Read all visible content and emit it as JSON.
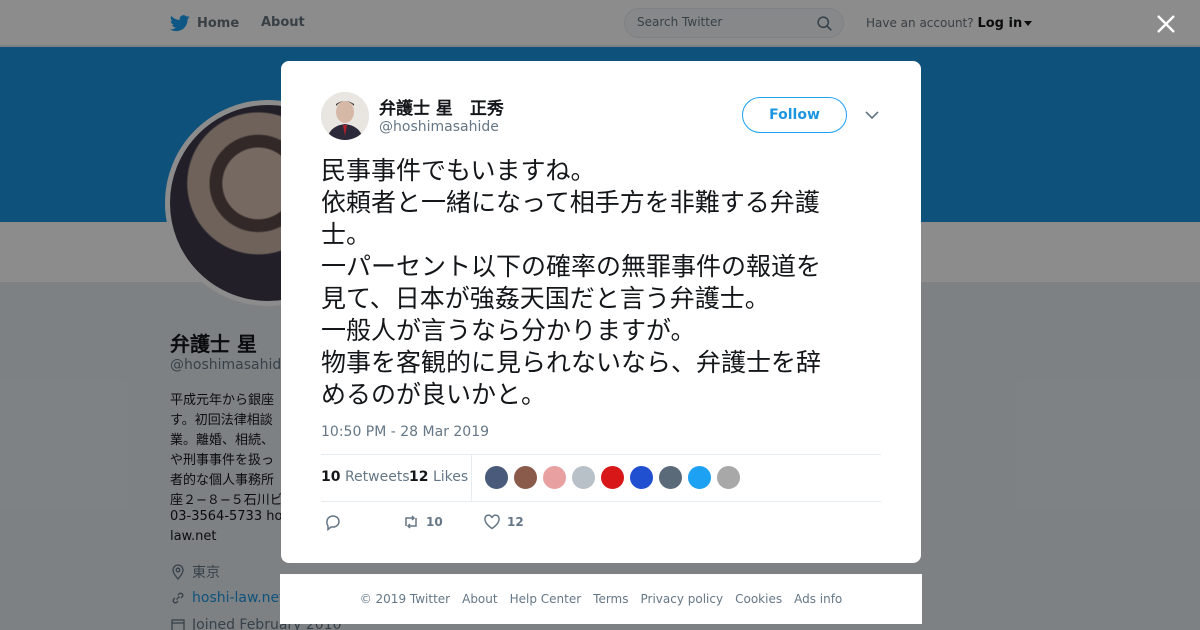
{
  "nav": {
    "home": "Home",
    "about": "About",
    "search_placeholder": "Search Twitter",
    "account_prompt": "Have an account?",
    "login": "Log in"
  },
  "profile": {
    "name": "弁護士 星",
    "handle": "@hoshimasahide",
    "bio_lines": [
      "平成元年から銀座",
      "す。初回法律相談",
      "業。離婚、相続、",
      "や刑事事件を扱っ",
      "者的な個人事務所",
      "座２−８−５石川ビ",
      "03-3564-5733 hos",
      "law.net"
    ],
    "location": "東京",
    "website": "hoshi-law.net",
    "joined": "Joined February 2010"
  },
  "tweet": {
    "author_name": "弁護士 星　正秀",
    "author_handle": "@hoshimasahide",
    "follow_label": "Follow",
    "text_lines": [
      "民事事件でもいますね。",
      "依頼者と一緒になって相手方を非難する弁護",
      "士。",
      "一パーセント以下の確率の無罪事件の報道を",
      "見て、日本が強姦天国だと言う弁護士。",
      "一般人が言うなら分かりますが。",
      "物事を客観的に見られないなら、弁護士を辞",
      "めるのが良いかと。"
    ],
    "timestamp": "10:50 PM - 28 Mar 2019",
    "retweets_count": "10",
    "retweets_label": "Retweets",
    "likes_count": "12",
    "likes_label": "Likes",
    "reply_count": "",
    "retweet_action_count": "10",
    "like_action_count": "12"
  },
  "likers": [
    {
      "name": "liker-1",
      "color": "#4a5a7a"
    },
    {
      "name": "liker-2",
      "color": "#8a5a4a"
    },
    {
      "name": "liker-3",
      "color": "#e8a0a0"
    },
    {
      "name": "liker-4",
      "color": "#b8c0c8"
    },
    {
      "name": "liker-5",
      "color": "#d81818"
    },
    {
      "name": "liker-6",
      "color": "#2050d0"
    },
    {
      "name": "liker-7",
      "color": "#5a6a78"
    },
    {
      "name": "liker-8",
      "color": "#1da1f2"
    },
    {
      "name": "liker-9",
      "color": "#a8a8a8"
    }
  ],
  "footer": {
    "copyright": "© 2019 Twitter",
    "links": [
      "About",
      "Help Center",
      "Terms",
      "Privacy policy",
      "Cookies",
      "Ads info"
    ]
  },
  "colors": {
    "brand": "#1da1f2",
    "banner": "#1b95e0",
    "overlay": "rgba(0,0,0,0.45)"
  }
}
